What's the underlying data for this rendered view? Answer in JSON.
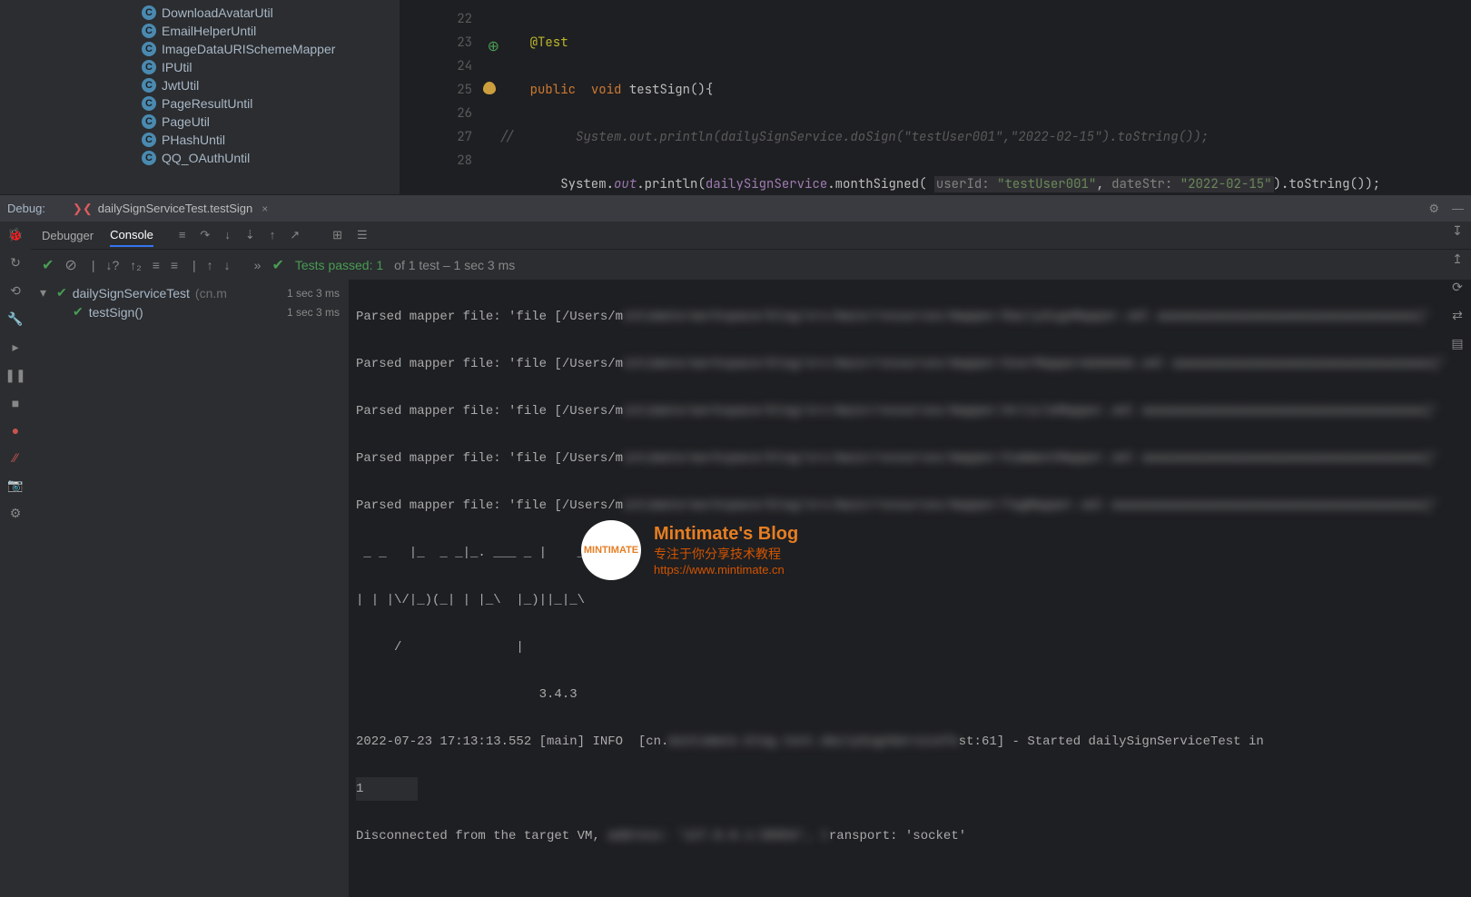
{
  "project_tree": [
    "DownloadAvatarUtil",
    "EmailHelperUntil",
    "ImageDataURISchemeMapper",
    "IPUtil",
    "JwtUtil",
    "PageResultUntil",
    "PageUtil",
    "PHashUntil",
    "QQ_OAuthUntil"
  ],
  "editor": {
    "lines": [
      "22",
      "23",
      "24",
      "25",
      "26",
      "27",
      "28"
    ],
    "annotation": "@Test",
    "kw_public": "public",
    "kw_void": "void",
    "method_name": "testSign",
    "comment_line": "//        System.out.println(dailySignService.doSign(\"testUser001\",\"2022-02-15\").toString());",
    "call_system": "System",
    "call_out": "out",
    "call_println": "println",
    "service_name": "dailySignService",
    "service_method": "monthSigned",
    "param1_name": "userId:",
    "param1_val": "\"testUser001\"",
    "param2_name": "dateStr:",
    "param2_val": "\"2022-02-15\"",
    "tostring": "toString"
  },
  "debug": {
    "label": "Debug:",
    "tab_name": "dailySignServiceTest.testSign"
  },
  "tool_tabs": {
    "debugger": "Debugger",
    "console": "Console"
  },
  "tests": {
    "passed_label": "Tests passed:",
    "passed_count": "1",
    "of_info": "of 1 test – 1 sec 3 ms",
    "root_name": "dailySignServiceTest",
    "root_pkg": "(cn.m",
    "root_time": "1 sec 3 ms",
    "child_name": "testSign()",
    "child_time": "1 sec 3 ms"
  },
  "console": {
    "l1": "Parsed mapper file: 'file [/Users/m",
    "l2": "Parsed mapper file: 'file [/Users/m",
    "l3": "Parsed mapper file: 'file [/Users/m",
    "l4": "Parsed mapper file: 'file [/Users/m",
    "l5": "Parsed mapper file: 'file [/Users/m",
    "ascii1": " _ _   |_  _ _|_. ___ _ |    _ ",
    "ascii2": "| | |\\/|_)(_| | |_\\  |_)||_|_\\ ",
    "ascii3": "     /               |         ",
    "ascii4": "                        3.4.3 ",
    "log_pre": "2022-07-23 17:13:13.552 [main] INFO  [cn.",
    "log_post": "st:61] - Started dailySignServiceTest in",
    "result": "1",
    "disc_pre": "Disconnected from the target VM,",
    "disc_post": "ransport: 'socket'"
  },
  "watermark": {
    "title": "Mintimate's Blog",
    "sub": "专注于你分享技术教程",
    "url": "https://www.mintimate.cn",
    "logo": "MINTIMATE"
  }
}
